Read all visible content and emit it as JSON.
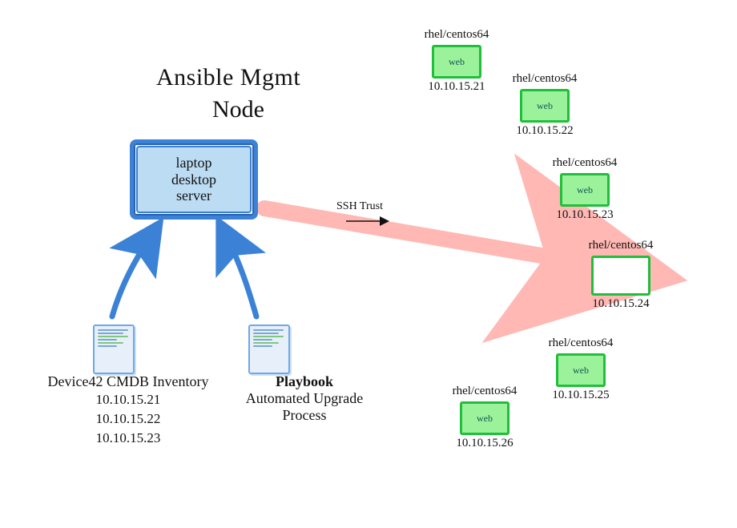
{
  "title": {
    "line1": "Ansible Mgmt",
    "line2": "Node"
  },
  "mgmt_box": {
    "l1": "laptop",
    "l2": "desktop",
    "l3": "server"
  },
  "ssh_label": "SSH Trust",
  "inventory": {
    "title": "Device42 CMDB Inventory",
    "ips": [
      "10.10.15.21",
      "10.10.15.22",
      "10.10.15.23"
    ]
  },
  "playbook": {
    "title": "Playbook",
    "l1": "Automated Upgrade",
    "l2": "Process"
  },
  "nodes": [
    {
      "os": "rhel/centos64",
      "label": "web",
      "ip": "10.10.15.21",
      "blank": false
    },
    {
      "os": "rhel/centos64",
      "label": "web",
      "ip": "10.10.15.22",
      "blank": false
    },
    {
      "os": "rhel/centos64",
      "label": "web",
      "ip": "10.10.15.23",
      "blank": false
    },
    {
      "os": "rhel/centos64",
      "label": "",
      "ip": "10.10.15.24",
      "blank": true
    },
    {
      "os": "rhel/centos64",
      "label": "web",
      "ip": "10.10.15.25",
      "blank": false
    },
    {
      "os": "rhel/centos64",
      "label": "web",
      "ip": "10.10.15.26",
      "blank": false
    }
  ],
  "colors": {
    "blue": "#3b82d6",
    "pink": "#ffb8b4",
    "green": "#1fbf3a"
  }
}
